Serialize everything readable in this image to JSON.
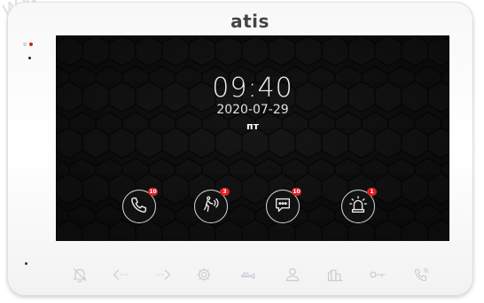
{
  "device": {
    "brand": "atis",
    "watermark": "www"
  },
  "screen": {
    "time": "09:40",
    "date": "2020-07-29",
    "weekday": "пт"
  },
  "apps": [
    {
      "icon": "phone-icon",
      "badge": "10"
    },
    {
      "icon": "motion-detection-icon",
      "badge": "3"
    },
    {
      "icon": "message-icon",
      "badge": "10"
    },
    {
      "icon": "alarm-icon",
      "badge": "1"
    }
  ],
  "touch_keys": [
    "bell-mute-icon",
    "arrow-left-icon",
    "arrow-right-icon",
    "gear-icon",
    "monitor-icon",
    "user-icon",
    "intercom-icon",
    "key-icon",
    "call-icon"
  ],
  "colors": {
    "badge": "#e02020",
    "led_red": "#d42020",
    "key_icon": "#c8c8d4"
  }
}
